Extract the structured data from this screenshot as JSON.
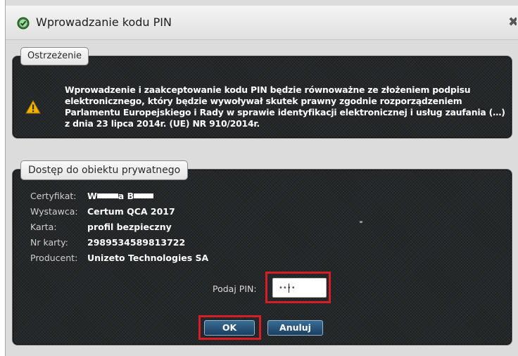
{
  "window": {
    "title": "Wprowadzanie kodu PIN",
    "close_glyph": "✖"
  },
  "warning": {
    "legend": "Ostrzeżenie",
    "icon": "warning-triangle-icon",
    "text": "Wprowadzenie i zaakceptowanie kodu PIN będzie równoważne ze złożeniem podpisu elektronicznego, który będzie wywoływał skutek prawny zgodnie rozporządzeniem Parlamentu Europejskiego i Rady w sprawie identyfikacji elektronicznej i usług zaufania (…) z dnia 23 lipca 2014r. (UE) NR 910/2014r."
  },
  "access": {
    "legend": "Dostęp do obiektu prywatnego",
    "certificate": {
      "label": "Certyfikat:",
      "value_part1": "W",
      "value_part2": "a B"
    },
    "issuer": {
      "label": "Wystawca:",
      "value": "Certum QCA 2017"
    },
    "card": {
      "label": "Karta:",
      "value": "profil bezpieczny"
    },
    "card_number": {
      "label": "Nr karty:",
      "value": "2989534589813722"
    },
    "producer": {
      "label": "Producent:",
      "value": "Unizeto Technologies SA"
    },
    "pin_label": "Podaj PIN:",
    "pin_value": "••••",
    "ok_label": "OK",
    "cancel_label": "Anuluj"
  },
  "colors": {
    "panel_bg": "#25282a",
    "highlight": "#d51f26",
    "button": "#1a3f5f",
    "warning_icon": "#f0b400"
  }
}
